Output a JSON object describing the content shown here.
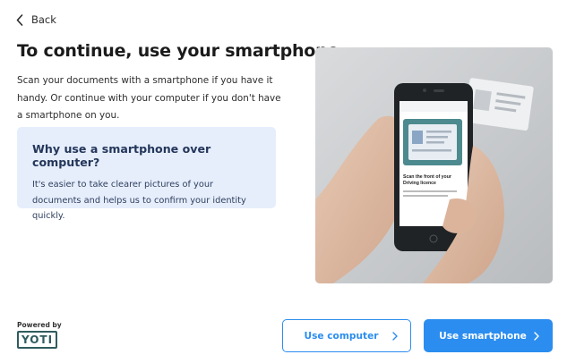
{
  "nav": {
    "back_label": "Back"
  },
  "page": {
    "title": "To continue, use your smartphone",
    "intro": "Scan your documents with a smartphone if you have it handy. Or continue with your computer if you don't have a smartphone on you."
  },
  "info_box": {
    "heading": "Why use a smartphone over computer?",
    "body": "It's easier to take clearer pictures of your documents and helps us to confirm your identity quickly."
  },
  "illustration": {
    "screen_title": "Scan the front of your Driving licence",
    "screen_small_text": "We'll automatically scan your driving licence when it's in position."
  },
  "footer": {
    "powered_by": "Powered by",
    "logo_text": "YOTI"
  },
  "buttons": {
    "computer_label": "Use computer",
    "smartphone_label": "Use smartphone"
  },
  "colors": {
    "accent": "#2b8def",
    "info_bg": "#e6eefc",
    "logo": "#2f5b5e"
  }
}
